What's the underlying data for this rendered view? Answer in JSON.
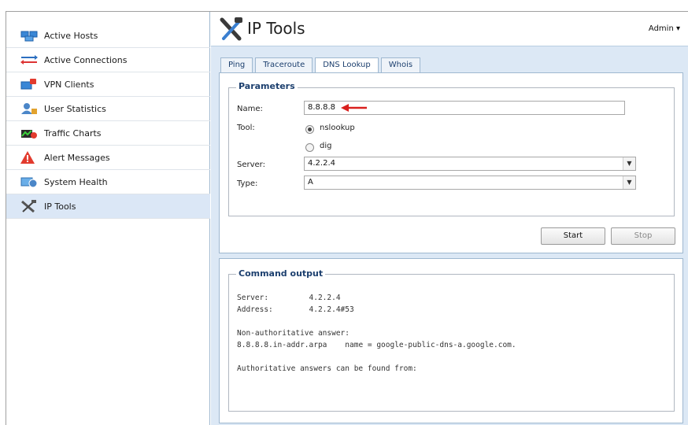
{
  "sidebar": {
    "items": [
      {
        "label": "Active Hosts",
        "icon": "network-hosts-icon",
        "active": false
      },
      {
        "label": "Active Connections",
        "icon": "connections-icon",
        "active": false
      },
      {
        "label": "VPN Clients",
        "icon": "vpn-clients-icon",
        "active": false
      },
      {
        "label": "User Statistics",
        "icon": "user-statistics-icon",
        "active": false
      },
      {
        "label": "Traffic Charts",
        "icon": "traffic-charts-icon",
        "active": false
      },
      {
        "label": "Alert Messages",
        "icon": "alert-icon",
        "active": false
      },
      {
        "label": "System Health",
        "icon": "system-health-icon",
        "active": false
      },
      {
        "label": "IP Tools",
        "icon": "tools-icon",
        "active": true
      }
    ]
  },
  "header": {
    "title": "IP Tools",
    "user_menu": "Admin ▾"
  },
  "tabs": [
    {
      "label": "Ping",
      "active": false
    },
    {
      "label": "Traceroute",
      "active": false
    },
    {
      "label": "DNS Lookup",
      "active": true
    },
    {
      "label": "Whois",
      "active": false
    }
  ],
  "params": {
    "legend": "Parameters",
    "name_label": "Name:",
    "name_value": "8.8.8.8",
    "tool_label": "Tool:",
    "tool_options": [
      "nslookup",
      "dig"
    ],
    "tool_selected": "nslookup",
    "server_label": "Server:",
    "server_value": "4.2.2.4",
    "type_label": "Type:",
    "type_value": "A",
    "start_label": "Start",
    "stop_label": "Stop"
  },
  "output": {
    "legend": "Command output",
    "text": "Server:\t\t4.2.2.4\nAddress:\t4.2.2.4#53\n\nNon-authoritative answer:\n8.8.8.8.in-addr.arpa\tname = google-public-dns-a.google.com.\n\nAuthoritative answers can be found from:"
  },
  "colors": {
    "accent": "#1c3f6e",
    "annotation_arrow": "#d9201e",
    "main_background": "#dce8f5",
    "sidebar_active": "#dbe7f6"
  }
}
